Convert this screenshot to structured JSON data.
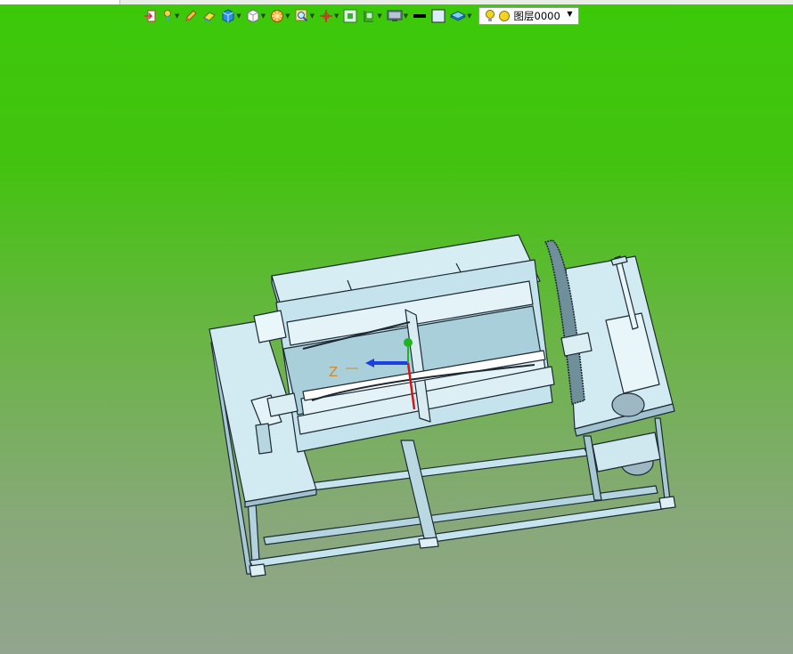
{
  "toolbar": {
    "tools": [
      {
        "icon": "exit-icon",
        "dropdown": false
      },
      {
        "icon": "pin-light-icon",
        "dropdown": true
      },
      {
        "icon": "pencil-icon",
        "dropdown": false
      },
      {
        "icon": "eraser-icon",
        "dropdown": false
      },
      {
        "icon": "cube-blue-icon",
        "dropdown": true
      },
      {
        "icon": "cube-white-icon",
        "dropdown": true
      },
      {
        "icon": "sphere-section-icon",
        "dropdown": true
      },
      {
        "icon": "zoom-icon",
        "dropdown": true
      },
      {
        "icon": "axis-icon",
        "dropdown": true
      },
      {
        "icon": "fit-view-icon",
        "dropdown": false
      },
      {
        "icon": "section-view-icon",
        "dropdown": true
      },
      {
        "icon": "display-mode-icon",
        "dropdown": true
      },
      {
        "icon": "line-style-icon",
        "dropdown": false
      },
      {
        "icon": "color-swatch-icon",
        "dropdown": false
      },
      {
        "icon": "layers-icon",
        "dropdown": true
      }
    ],
    "layer_selector": {
      "name": "图层0000",
      "colors": {
        "bulb": "#f5d420",
        "dot": "#f5d420"
      }
    }
  },
  "viewport": {
    "axis_label": "Z",
    "colors": {
      "model": "#bfe0ea",
      "edge": "#1d2a33",
      "axis_x": "#d21515",
      "axis_z": "#1b3fe0",
      "axis_y": "#1fb31f",
      "axis_label": "#d08a2c"
    }
  }
}
